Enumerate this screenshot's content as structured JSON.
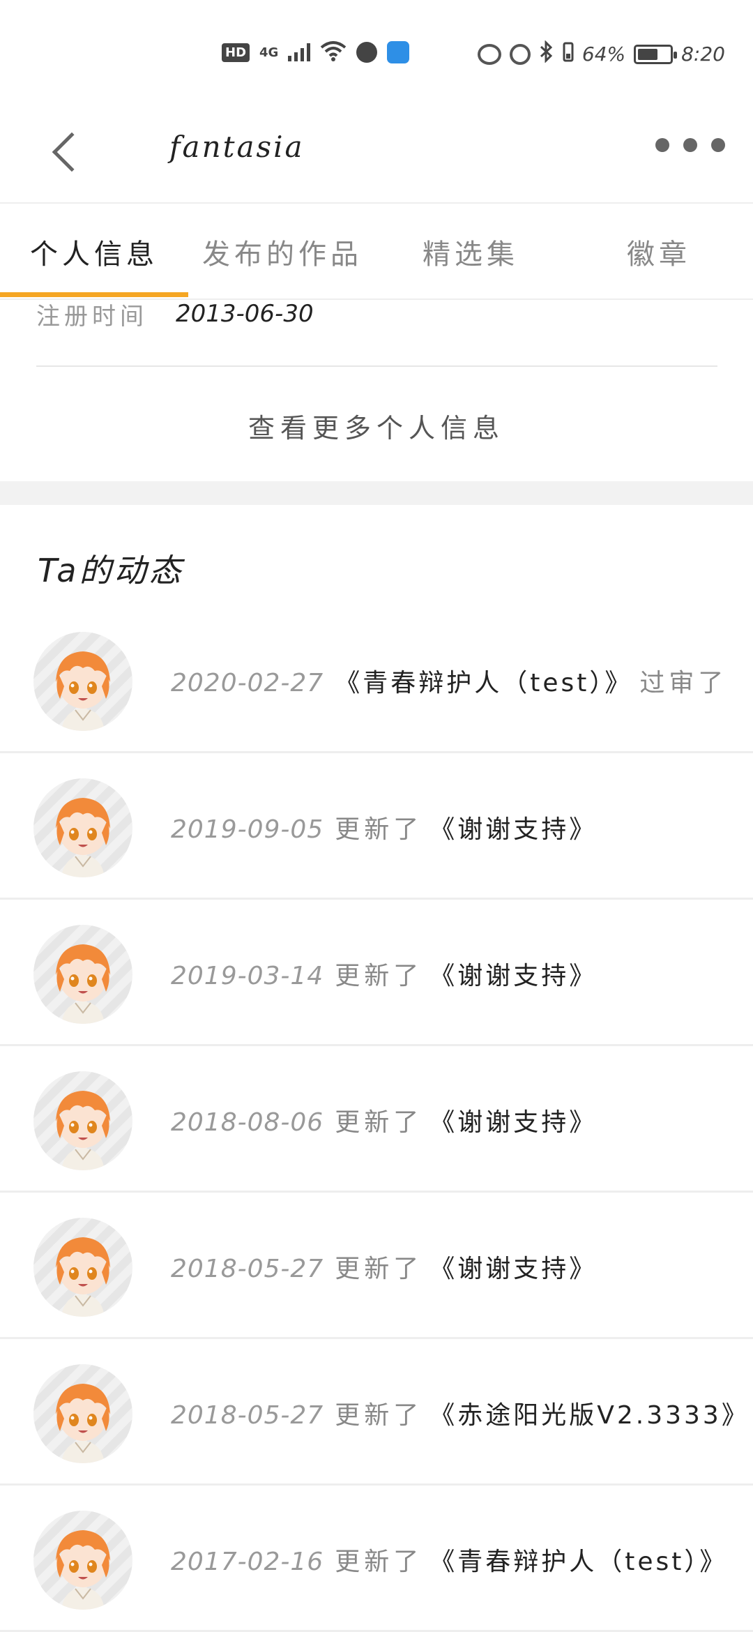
{
  "status_bar": {
    "network_badge": "HD",
    "network_type": "4G",
    "battery_percent": "64%",
    "battery_level": 0.64,
    "time": "8:20"
  },
  "header": {
    "title": "fantasia",
    "back_icon": "chevron-left-icon",
    "more_icon": "more-dots-icon"
  },
  "tabs": [
    {
      "label": "个人信息",
      "active": true
    },
    {
      "label": "发布的作品",
      "active": false
    },
    {
      "label": "精选集",
      "active": false
    },
    {
      "label": "徽章",
      "active": false
    }
  ],
  "profile": {
    "register_label": "注册时间",
    "register_value": "2013-06-30",
    "more_info_label": "查看更多个人信息"
  },
  "activity": {
    "title": "Ta的动态",
    "items": [
      {
        "date": "2020-02-27",
        "action": "",
        "work": "《青春辩护人（test）》",
        "suffix": "过审了"
      },
      {
        "date": "2019-09-05",
        "action": "更新了",
        "work": "《谢谢支持》",
        "suffix": ""
      },
      {
        "date": "2019-03-14",
        "action": "更新了",
        "work": "《谢谢支持》",
        "suffix": ""
      },
      {
        "date": "2018-08-06",
        "action": "更新了",
        "work": "《谢谢支持》",
        "suffix": ""
      },
      {
        "date": "2018-05-27",
        "action": "更新了",
        "work": "《谢谢支持》",
        "suffix": ""
      },
      {
        "date": "2018-05-27",
        "action": "更新了",
        "work": "《赤途阳光版V2.3333》",
        "suffix": ""
      },
      {
        "date": "2017-02-16",
        "action": "更新了",
        "work": "《青春辩护人（test）》",
        "suffix": ""
      }
    ]
  },
  "colors": {
    "accent": "#f5a623",
    "hair": "#f28a3a",
    "divider": "#eeeeee"
  }
}
